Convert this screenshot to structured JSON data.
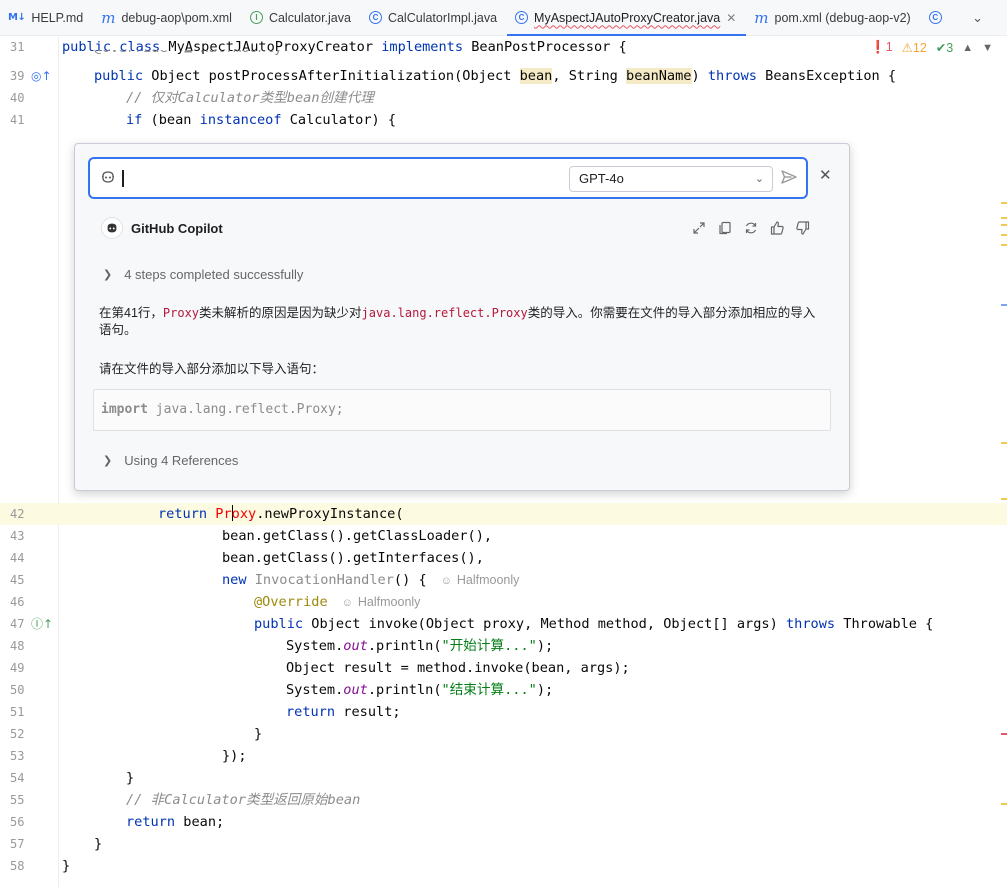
{
  "tabs": [
    {
      "icon": "M↓",
      "icon_kind": "md",
      "label": "HELP.md",
      "active": false,
      "close": false
    },
    {
      "icon": "m",
      "icon_kind": "m",
      "label": "debug-aop\\pom.xml",
      "active": false,
      "close": false
    },
    {
      "icon": "I",
      "icon_kind": "circ-green",
      "label": "Calculator.java",
      "active": false,
      "close": false
    },
    {
      "icon": "C",
      "icon_kind": "circ-blue",
      "label": "CalCulatorImpl.java",
      "active": false,
      "close": false
    },
    {
      "icon": "C",
      "icon_kind": "circ-blue",
      "label": "MyAspectJAutoProxyCreator.java",
      "active": true,
      "close": true
    },
    {
      "icon": "m",
      "icon_kind": "m",
      "label": "pom.xml (debug-aop-v2)",
      "active": false,
      "close": false
    }
  ],
  "tabs_more_icon": "chevron-down-icon",
  "inspections": {
    "errors": "1",
    "warnings": "12",
    "ok": "3"
  },
  "editor": {
    "sticky_line": {
      "num": "31",
      "text": "public class MyAspectJAutoProxyCreator implements BeanPostProcessor {"
    },
    "faded_text": "@Override  ▲ Halfmoonly",
    "lines": {
      "l39": "39",
      "l40": "40",
      "l41": "41",
      "l42": "42",
      "l43": "43",
      "l44": "44",
      "l45": "45",
      "l46": "46",
      "l47": "47",
      "l48": "48",
      "l49": "49",
      "l50": "50",
      "l51": "51",
      "l52": "52",
      "l53": "53",
      "l54": "54",
      "l55": "55",
      "l56": "56",
      "l57": "57",
      "l58": "58"
    },
    "comment_40": "// 仅对Calculator类型bean创建代理",
    "comment_55": "// 非Calculator类型返回原始bean",
    "author_45": "Halfmoonly",
    "author_46": "Halfmoonly",
    "str_48": "\"开始计算...\"",
    "str_50": "\"结束计算...\""
  },
  "copilot": {
    "input_value": "",
    "model": "GPT-4o",
    "title": "GitHub Copilot",
    "steps": "4 steps completed successfully",
    "answer_p1_a": "在第41行，",
    "answer_p1_code1": "Proxy",
    "answer_p1_b": "类未解析的原因是因为缺少对",
    "answer_p1_code2": "java.lang.reflect.Proxy",
    "answer_p1_c": "类的导入。你需要在文件的导入部分添加相应的导入语句。",
    "answer_p2": "请在文件的导入部分添加以下导入语句：",
    "code_kw": "import",
    "code_rest": " java.lang.reflect.Proxy;",
    "references": "Using 4 References"
  },
  "colors": {
    "accent": "#3574f0",
    "keyword": "#0033b3",
    "string": "#067d17",
    "comment": "#8c8c8c",
    "error": "#e55765",
    "warning": "#f0a732"
  }
}
